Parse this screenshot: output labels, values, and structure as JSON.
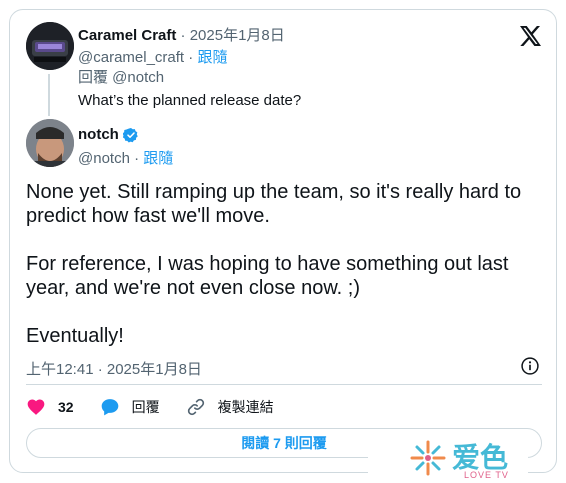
{
  "reply_tweet": {
    "author_name": "Caramel Craft",
    "date": "2025年1月8日",
    "handle": "@caramel_craft",
    "follow_label": "跟隨",
    "replying_label": "回覆 @notch",
    "text": "What’s the planned release date?"
  },
  "main_tweet": {
    "author_name": "notch",
    "handle": "@notch",
    "follow_label": "跟隨",
    "paragraphs": [
      "None yet. Still ramping up the team, so it's really hard to predict how fast we'll move.",
      "For reference, I was hoping to have something out last year, and we're not even close now. ;)",
      "Eventually!"
    ],
    "timestamp": "上午12:41 · 2025年1月8日"
  },
  "actions": {
    "like_count": "32",
    "reply_label": "回覆",
    "copy_link_label": "複製連結"
  },
  "read_replies_label": "閱讀 7 則回覆",
  "watermark": {
    "text": "爱色",
    "sub": "LOVE TV"
  },
  "colors": {
    "accent": "#1d9bf0",
    "like": "#f91880",
    "text": "#0f1419",
    "muted": "#536471",
    "border": "#cfd9de"
  },
  "icons": [
    "x-logo-icon",
    "verified-badge-icon",
    "heart-icon",
    "reply-bubble-icon",
    "link-icon",
    "info-icon"
  ]
}
